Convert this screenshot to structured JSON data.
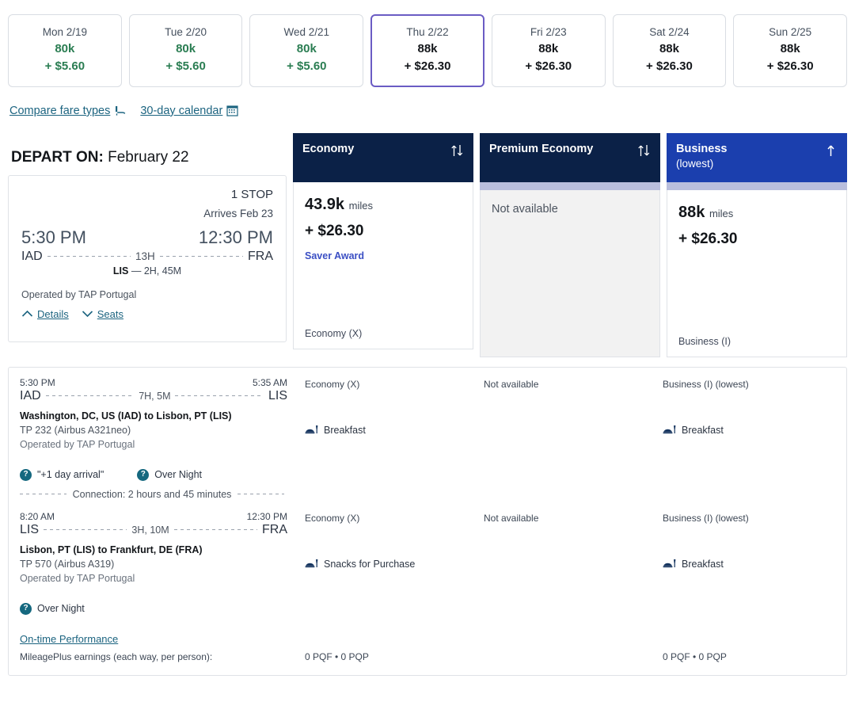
{
  "date_strip": [
    {
      "label": "Mon 2/19",
      "miles": "80k",
      "cash": "+ $5.60",
      "selected": false,
      "cheap": true
    },
    {
      "label": "Tue 2/20",
      "miles": "80k",
      "cash": "+ $5.60",
      "selected": false,
      "cheap": true
    },
    {
      "label": "Wed 2/21",
      "miles": "80k",
      "cash": "+ $5.60",
      "selected": false,
      "cheap": true
    },
    {
      "label": "Thu 2/22",
      "miles": "88k",
      "cash": "+ $26.30",
      "selected": true,
      "cheap": false
    },
    {
      "label": "Fri 2/23",
      "miles": "88k",
      "cash": "+ $26.30",
      "selected": false,
      "cheap": false
    },
    {
      "label": "Sat 2/24",
      "miles": "88k",
      "cash": "+ $26.30",
      "selected": false,
      "cheap": false
    },
    {
      "label": "Sun 2/25",
      "miles": "88k",
      "cash": "+ $26.30",
      "selected": false,
      "cheap": false
    }
  ],
  "links": {
    "compare_fare_types": "Compare fare types",
    "compare_icon": "seat-icon",
    "calendar": "30-day calendar",
    "calendar_icon": "calendar-icon"
  },
  "depart": {
    "prefix": "DEPART ON:",
    "date": " February 22"
  },
  "summary": {
    "stops": "1 STOP",
    "arrives": "Arrives Feb 23",
    "depart_time": "5:30 PM",
    "arrive_time": "12:30 PM",
    "origin": "IAD",
    "destination": "FRA",
    "duration": "13H",
    "stop_code": "LIS",
    "stop_layover": "— 2H, 45M",
    "operated_by": "Operated by TAP Portugal",
    "details_label": "Details",
    "seats_label": "Seats"
  },
  "cabins": [
    {
      "name": "Economy",
      "sub": "",
      "style": "navy",
      "sort_icon": "sort-updown-icon",
      "strip": false,
      "available": true,
      "miles": "43.9k",
      "miles_unit": "miles",
      "cash": "+ $26.30",
      "tag": "Saver Award",
      "footer": "Economy (X)"
    },
    {
      "name": "Premium Economy",
      "sub": "",
      "style": "navy",
      "sort_icon": "sort-updown-icon",
      "strip": true,
      "available": false,
      "not_available": "Not available",
      "footer": ""
    },
    {
      "name": "Business",
      "sub": "(lowest)",
      "style": "blue",
      "sort_icon": "sort-up-icon",
      "strip": true,
      "available": true,
      "miles": "88k",
      "miles_unit": "miles",
      "cash": "+ $26.30",
      "tag": "",
      "footer": "Business (I)"
    }
  ],
  "segments": [
    {
      "depart_time": "5:30 PM",
      "arrive_time": "5:35 AM",
      "origin": "IAD",
      "destination": "LIS",
      "duration": "7H, 5M",
      "city_pair": "Washington, DC, US (IAD) to Lisbon, PT (LIS)",
      "equipment": "TP 232 (Airbus A321neo)",
      "operated_by": "Operated by TAP Portugal",
      "badges": [
        {
          "icon": "question-icon",
          "label": "\"+1 day arrival\""
        },
        {
          "icon": "question-icon",
          "label": "Over Night"
        }
      ],
      "economy_cabin": "Economy (X)",
      "economy_meal": "Breakfast",
      "premium_cabin": "Not available",
      "premium_meal": "",
      "business_cabin": "Business (I) (lowest)",
      "business_meal": "Breakfast",
      "connection": "Connection: 2 hours and 45 minutes"
    },
    {
      "depart_time": "8:20 AM",
      "arrive_time": "12:30 PM",
      "origin": "LIS",
      "destination": "FRA",
      "duration": "3H, 10M",
      "city_pair": "Lisbon, PT (LIS) to Frankfurt, DE (FRA)",
      "equipment": "TP 570 (Airbus A319)",
      "operated_by": "Operated by TAP Portugal",
      "badges": [
        {
          "icon": "question-icon",
          "label": "Over Night"
        }
      ],
      "economy_cabin": "Economy (X)",
      "economy_meal": "Snacks for Purchase",
      "premium_cabin": "Not available",
      "premium_meal": "",
      "business_cabin": "Business (I) (lowest)",
      "business_meal": "Breakfast",
      "connection": ""
    }
  ],
  "footer": {
    "on_time_performance": "On-time Performance",
    "earnings_label": "MileagePlus earnings (each way, per person):",
    "economy_earnings": "0 PQF • 0 PQP",
    "premium_earnings": "",
    "business_earnings": "0 PQF • 0 PQP"
  },
  "colors": {
    "navy": "#0b2147",
    "blue": "#1b3fae",
    "green": "#2a7d52",
    "link": "#1c6480",
    "accent_purple": "#6b5cc4",
    "lavender": "#b9bedd",
    "teal_badge": "#15687f"
  }
}
